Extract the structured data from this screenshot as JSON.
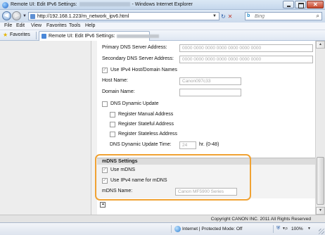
{
  "window": {
    "title_prefix": "Remote UI: Edit IPv6 Settings:",
    "title_suffix": "- Windows Internet Explorer"
  },
  "address": {
    "url_prefix": "http://192.168.1.223/",
    "url_suffix": "m_network_ipv6.html",
    "search_text": "Bing"
  },
  "menu": [
    "File",
    "Edit",
    "View",
    "Favorites",
    "Tools",
    "Help"
  ],
  "favorites": {
    "label": "Favorites",
    "tab_text": "Remote UI: Edit IPv6 Settings:"
  },
  "form": {
    "primary_dns_label": "Primary DNS Server Address:",
    "primary_dns_value": "0000 0000 0000 0000 0000 0000 0000",
    "secondary_dns_label": "Secondary DNS Server Address:",
    "secondary_dns_value": "0000 0000 0000 0000 0000 0000 0000",
    "use_ipv4_host_label": "Use IPv4 Host/Domain Names",
    "host_name_label": "Host Name:",
    "host_name_value": "Canon097c33",
    "domain_name_label": "Domain Name:",
    "domain_name_value": "",
    "dns_dynamic_update_label": "DNS Dynamic Update",
    "register_manual_label": "Register Manual Address",
    "register_stateful_label": "Register Stateful Address",
    "register_stateless_label": "Register Stateless Address",
    "dns_update_time_label": "DNS Dynamic Update Time:",
    "dns_update_time_value": "24",
    "dns_update_time_unit": "hr. (0-48)"
  },
  "mdns": {
    "section_title": "mDNS Settings",
    "use_mdns_label": "Use mDNS",
    "use_ipv4_name_label": "Use IPv4 name for mDNS",
    "mdns_name_label": "mDNS Name:",
    "mdns_name_value": "Canon MF5900 Series"
  },
  "footer": {
    "copyright": "Copyright CANON INC. 2011 All Rights Reserved"
  },
  "status": {
    "zone": "Internet | Protected Mode: Off",
    "zoom": "100%"
  },
  "colors": {
    "highlight": "#f0a233",
    "section_header": "#dcdcdc"
  }
}
